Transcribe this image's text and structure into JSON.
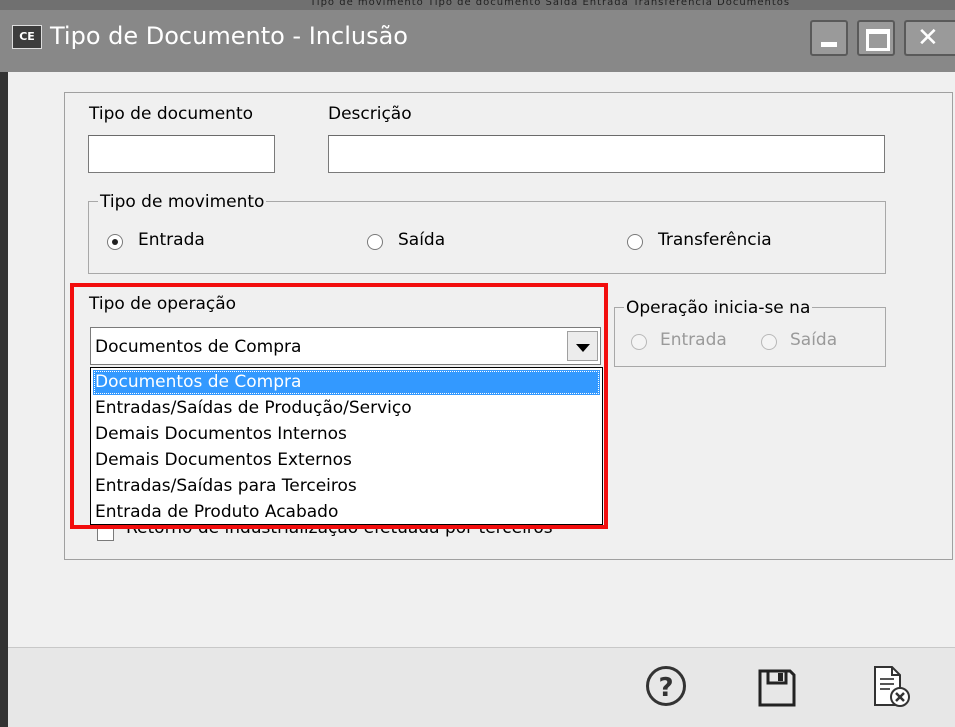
{
  "window": {
    "app_icon_text": "CE",
    "title": "Tipo de Documento - Inclusão",
    "background_strip_text": "Tipo de movimento Tipo de documento Saída Entrada Transferência Documentos"
  },
  "form": {
    "tipo_documento_label": "Tipo de documento",
    "tipo_documento_value": "",
    "descricao_label": "Descrição",
    "descricao_value": ""
  },
  "tipo_movimento": {
    "legend": "Tipo de movimento",
    "options": [
      {
        "label": "Entrada",
        "checked": true
      },
      {
        "label": "Saída",
        "checked": false
      },
      {
        "label": "Transferência",
        "checked": false
      }
    ]
  },
  "tipo_operacao": {
    "label": "Tipo de operação",
    "selected": "Documentos de Compra",
    "options": [
      "Documentos de Compra",
      "Entradas/Saídas de Produção/Serviço",
      "Demais Documentos Internos",
      "Demais Documentos Externos",
      "Entradas/Saídas para Terceiros",
      "Entrada de Produto Acabado"
    ],
    "highlight_color": "#f20d0d",
    "selection_color": "#3399ff"
  },
  "operacao_inicia": {
    "legend": "Operação inicia-se na",
    "options": [
      {
        "label": "Entrada",
        "enabled": false
      },
      {
        "label": "Saída",
        "enabled": false
      }
    ]
  },
  "retorno_checkbox": {
    "label": "Retorno de industrialização efetuada por terceiros",
    "checked": false
  },
  "toolbar": {
    "help_symbol": "?",
    "icons": [
      "help-icon",
      "save-icon",
      "cancel-document-icon"
    ]
  }
}
